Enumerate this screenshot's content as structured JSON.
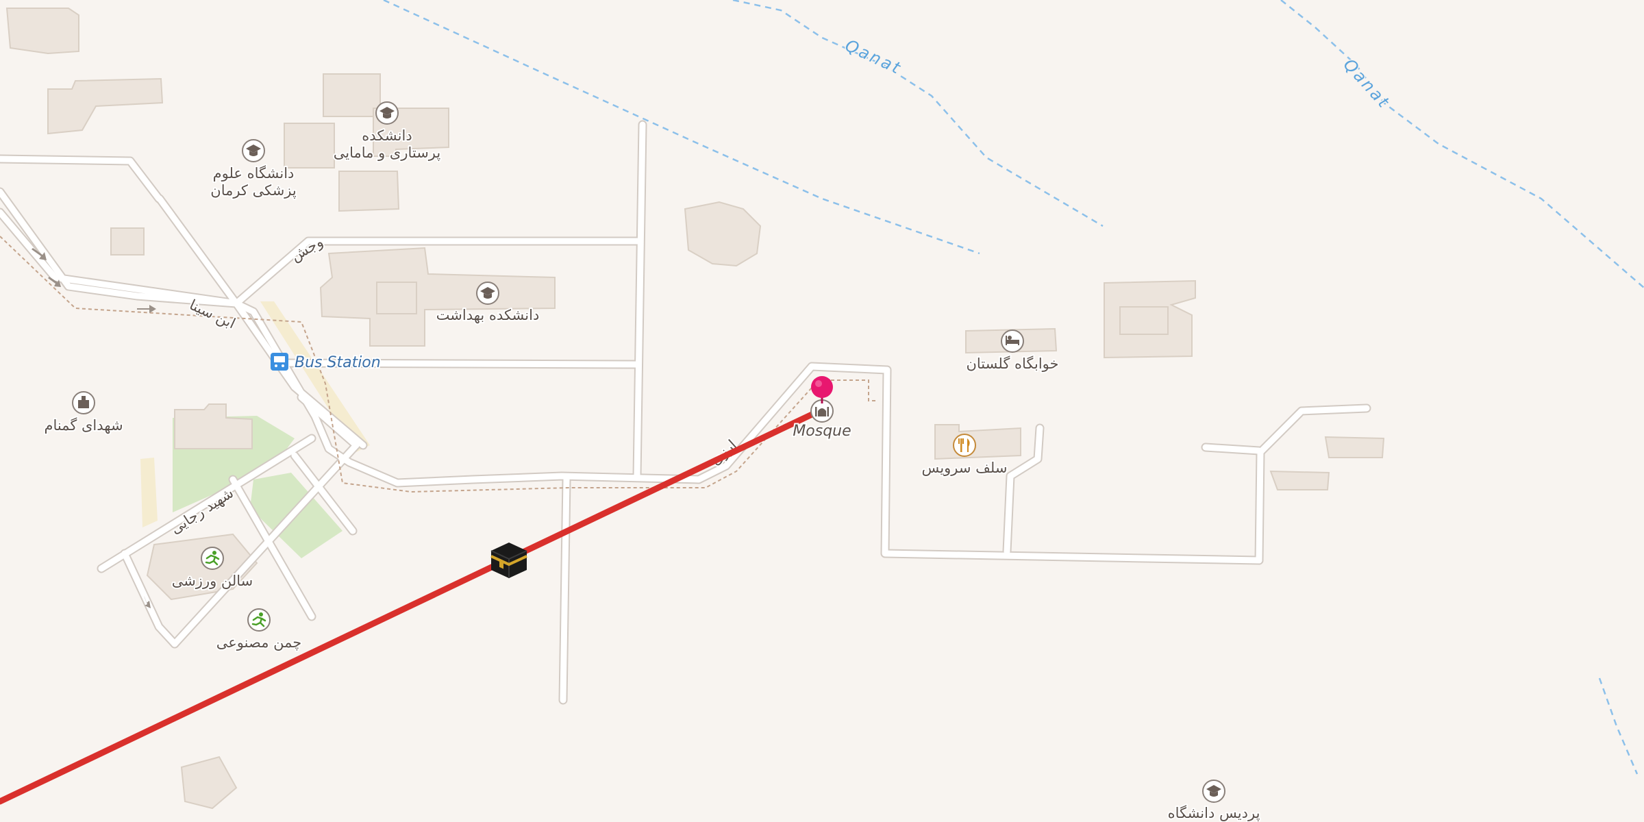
{
  "map": {
    "labels": {
      "qanat_1": "Qanat",
      "qanat_2": "Qanat",
      "nursing_school": "دانشکده\nپرستاری و مامایی",
      "medical_university": "دانشگاه علوم\nپزشکی کرمان",
      "health_school": "دانشکده بهداشت",
      "golestan_dorm": "خوابگاه گلستان",
      "bus_station": "Bus Station",
      "shohada": "شهدای گمنام",
      "mosque": "Mosque",
      "self_service": "سلف سرویس",
      "sports_hall": "سالن ورزشی",
      "artificial_turf": "چمن مصنوعی",
      "university_campus": "پردیس دانشگاه",
      "road_vojh": "وجش",
      "road_ebnesina": "ابن سینا",
      "road_shahidrajaee": "شهید رجایی",
      "road_razi": "ارزی"
    },
    "route": {
      "color": "#d9302c",
      "destination_marker_color": "#e8176f",
      "waypoint_icon": "kaaba-icon"
    },
    "icons": {
      "school": "graduation-cap-icon",
      "bus": "bus-icon",
      "mosque": "mosque-icon",
      "restaurant": "fork-knife-icon",
      "hotel": "bed-icon",
      "sport": "running-person-icon",
      "monument": "memorial-icon"
    },
    "colors": {
      "background": "#f8f4f0",
      "building": "#ece4dc",
      "park": "#d6e8c4",
      "water": "#5aa3dc",
      "road": "#ffffff",
      "bus_label": "#3a6fa8"
    }
  }
}
